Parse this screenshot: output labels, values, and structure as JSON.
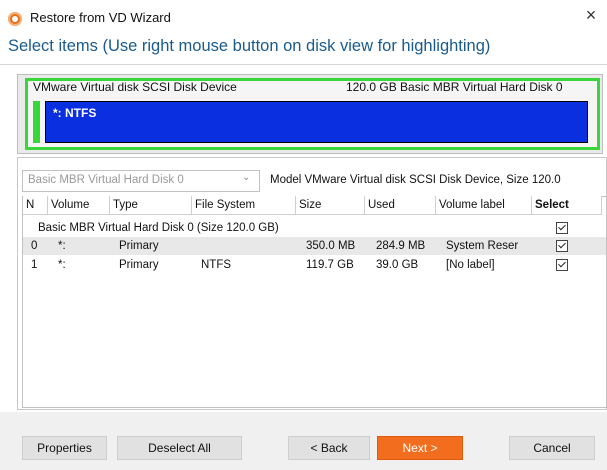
{
  "window": {
    "title": "Restore from VD Wizard",
    "close_glyph": "×"
  },
  "header": {
    "text": "Select items (Use right mouse button on disk view for highlighting)"
  },
  "disk_view": {
    "disk_name": "VMware Virtual disk SCSI Disk Device",
    "disk_info": "120.0 GB  Basic MBR Virtual Hard Disk 0",
    "partition_label": "*: NTFS",
    "highlight_color": "#39d639",
    "partition_color": "#0a2fe0"
  },
  "panel": {
    "disk_select_value": "Basic MBR Virtual Hard Disk 0",
    "model_text": "Model VMware Virtual disk SCSI Disk Device, Size 120.0"
  },
  "table": {
    "columns": [
      "N",
      "Volume",
      "Type",
      "File System",
      "Size",
      "Used",
      "Volume label",
      "Select"
    ],
    "group_label": "Basic MBR Virtual Hard Disk 0 (Size 120.0 GB)",
    "rows": [
      {
        "n": "0",
        "volume": "*:",
        "type": "Primary",
        "fs": "",
        "size": "350.0 MB",
        "used": "284.9 MB",
        "label": "System Reser­",
        "selected": true
      },
      {
        "n": "1",
        "volume": "*:",
        "type": "Primary",
        "fs": "NTFS",
        "size": "119.7 GB",
        "used": "39.0 GB",
        "label": "[No label]",
        "selected": true
      }
    ]
  },
  "footer": {
    "properties": "Properties",
    "deselect_all": "Deselect All",
    "back": "< Back",
    "next": "Next >",
    "cancel": "Cancel",
    "accent_color": "#f26d1e"
  },
  "icons": {
    "app": "wizard-app-icon",
    "close": "close-icon",
    "dropdown": "chevron-down-icon",
    "checkbox": "checkbox-checked-icon"
  }
}
